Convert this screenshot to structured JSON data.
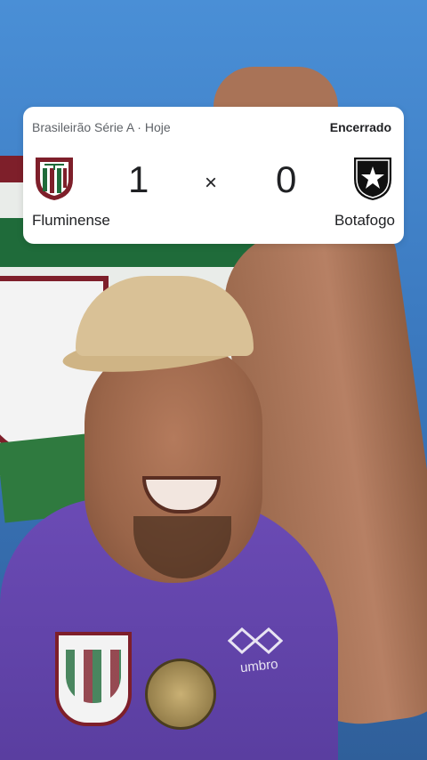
{
  "scoreboard": {
    "league": "Brasileirão Série A · Hoje",
    "status": "Encerrado",
    "separator": "×",
    "home": {
      "name": "Fluminense",
      "score": "1",
      "logo_icon": "fluminense-crest-icon"
    },
    "away": {
      "name": "Botafogo",
      "score": "0",
      "logo_icon": "botafogo-crest-icon"
    }
  },
  "video": {
    "shirt_brand": "umbro"
  },
  "colors": {
    "fluminense_grena": "#7e1f2a",
    "fluminense_green": "#1f6b3a",
    "shirt_purple": "#6b4bb5",
    "wall_blue": "#3f7fc4"
  }
}
